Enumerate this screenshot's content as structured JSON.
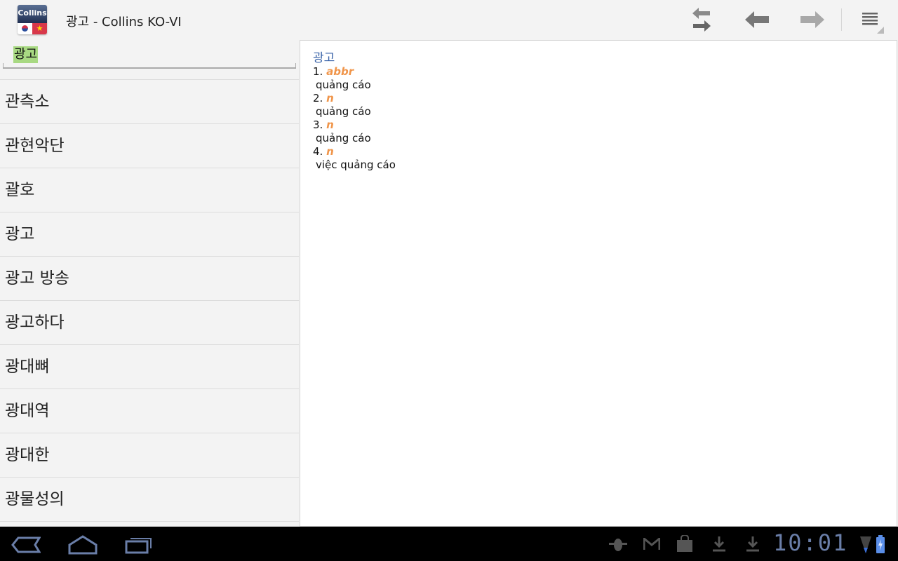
{
  "app": {
    "logo_text": "Collins",
    "title": "광고 - Collins KO-VI"
  },
  "toolbar": {
    "icons": [
      "swap-direction-icon",
      "back-arrow-icon",
      "forward-arrow-icon",
      "menu-icon"
    ]
  },
  "search": {
    "value": "광고"
  },
  "word_list": [
    "관측소",
    "관현악단",
    "괄호",
    "광고",
    "광고 방송",
    "광고하다",
    "광대뼈",
    "광대역",
    "광대한",
    "광물성의"
  ],
  "entry": {
    "headword": "광고",
    "senses": [
      {
        "num": "1.",
        "pos": "abbr",
        "translation": "quảng cáo"
      },
      {
        "num": "2.",
        "pos": "n",
        "translation": "quảng cáo"
      },
      {
        "num": "3.",
        "pos": "n",
        "translation": "quảng cáo"
      },
      {
        "num": "4.",
        "pos": "n",
        "translation": "việc quảng cáo"
      }
    ]
  },
  "colors": {
    "headword": "#3a63a8",
    "pos": "#f0954a",
    "search_highlight": "#a8d982",
    "clock": "#6a7ea8"
  },
  "statusbar": {
    "time": "10:01",
    "icons": [
      "debug-icon",
      "gmail-icon",
      "market-icon",
      "download-icon",
      "download-icon",
      "signal-icon",
      "battery-charging-icon"
    ]
  }
}
